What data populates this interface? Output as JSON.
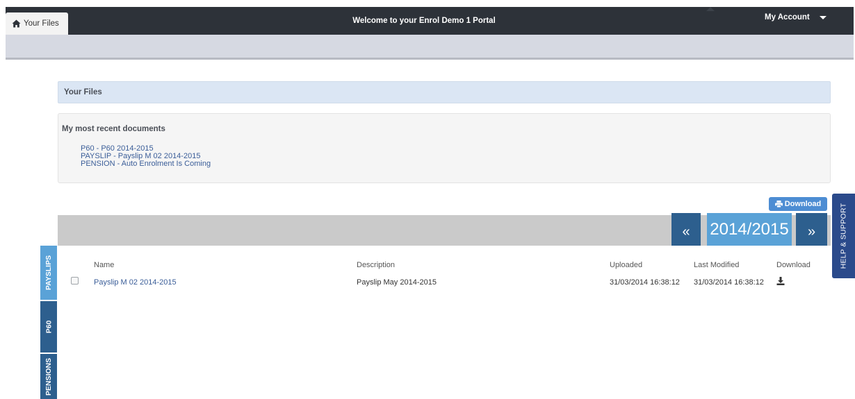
{
  "nav": {
    "home_tab": "Your Files",
    "title": "Welcome to your Enrol Demo 1 Portal",
    "account": "My Account"
  },
  "section_header": "Your Files",
  "recent": {
    "title": "My most recent documents",
    "items": [
      "P60 - P60 2014-2015",
      "PAYSLIP - Payslip M 02 2014-2015",
      "PENSION - Auto Enrolment Is Coming"
    ]
  },
  "download_button": "Download",
  "year_nav": {
    "prev": "«",
    "year": "2014/2015",
    "next": "»"
  },
  "table": {
    "headers": {
      "name": "Name",
      "description": "Description",
      "uploaded": "Uploaded",
      "last_modified": "Last Modified",
      "download": "Download"
    },
    "rows": [
      {
        "name": "Payslip M 02 2014-2015",
        "description": "Payslip May 2014-2015",
        "uploaded": "31/03/2014 16:38:12",
        "last_modified": "31/03/2014 16:38:12"
      }
    ]
  },
  "side_tabs": [
    "PAYSLIPS",
    "P60",
    "PENSIONS"
  ],
  "help_tab": "HELP & SUPPORT",
  "colors": {
    "navbar": "#2d3239",
    "subbar": "#d6d9e2",
    "accent_light": "#5aa2d7",
    "accent_dark": "#2d5f8e",
    "link": "#3a5d98",
    "help": "#2b4a8b",
    "download_button": "#4d8dd3"
  },
  "icons": {
    "home_tab": "home-icon",
    "download_button": "print-icon",
    "row_download": "download-icon",
    "account": "chevron-down-icon"
  }
}
